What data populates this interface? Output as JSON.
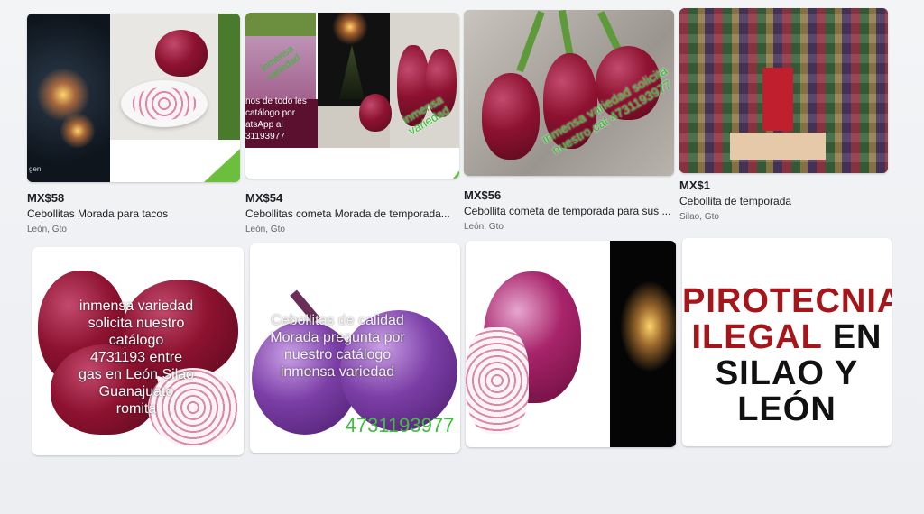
{
  "listings": [
    {
      "price": "MX$58",
      "title": "Cebollitas Morada para tacos",
      "location": "León, Gto",
      "image": {
        "corner_text": "gen"
      }
    },
    {
      "price": "MX$54",
      "title": "Cebollitas cometa Morada de temporada...",
      "location": "León, Gto",
      "image": {
        "banner": "inmensa variedad",
        "side_text": "nos de todo les\ncatálogo por\natsApp al\n31193977",
        "green_overlay": "inmensa variedad"
      }
    },
    {
      "price": "MX$56",
      "title": "Cebollita cometa de temporada para sus ...",
      "location": "León, Gto",
      "image": {
        "green_overlay": "inmensa variedad solicita nuestro cat 4731193977"
      }
    },
    {
      "price": "MX$1",
      "title": "Cebollita de temporada",
      "location": "Silao, Gto",
      "image": {}
    },
    {
      "image": {
        "overlay_text": "inmensa variedad\nsolicita nuestro\ncatálogo\n4731193 entre\ngas en León Silao\nGuanajuato\nromita"
      }
    },
    {
      "image": {
        "overlay_text": "Cebollitas de calidad\nMorada pregunta por\nnuestro catálogo\ninmensa variedad",
        "phone": "4731193977"
      }
    },
    {
      "image": {}
    },
    {
      "image": {
        "line1": "PIROTECNIA",
        "line2_red": "ILEGAL",
        "line2_black": " EN",
        "line3": "SILAO Y",
        "line4": "LEÓN"
      }
    }
  ],
  "colors": {
    "price": "#1c1e21",
    "location": "#65676b",
    "fire_red": "#a4161a",
    "green_overlay": "#2fbf2f"
  }
}
